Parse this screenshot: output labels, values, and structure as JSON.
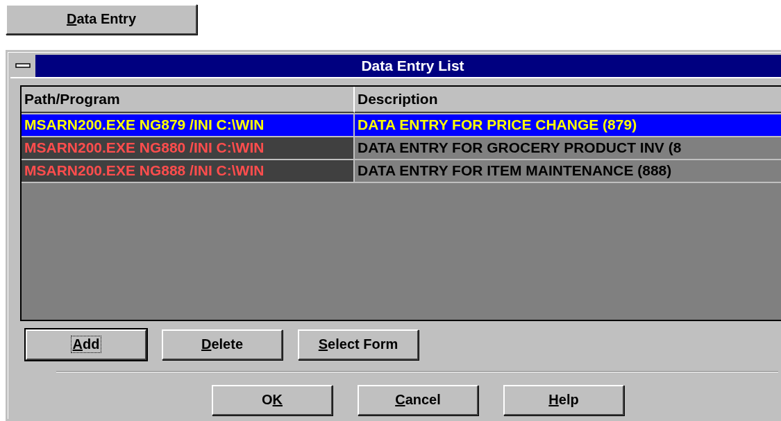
{
  "launcher_button": {
    "key": "D",
    "after": "ata Entry"
  },
  "window": {
    "title": "Data Entry List"
  },
  "table": {
    "columns": [
      "Path/Program",
      "Description"
    ],
    "rows": [
      {
        "selected": true,
        "cells": [
          "MSARN200.EXE NG879 /INI C:\\WIN",
          "DATA ENTRY FOR PRICE CHANGE (879)"
        ]
      },
      {
        "selected": false,
        "cells": [
          "MSARN200.EXE NG880 /INI C:\\WIN",
          "DATA ENTRY FOR GROCERY PRODUCT INV (8"
        ]
      },
      {
        "selected": false,
        "cells": [
          "MSARN200.EXE NG888 /INI C:\\WIN",
          "DATA ENTRY FOR ITEM MAINTENANCE (888)"
        ]
      }
    ]
  },
  "list_buttons": [
    {
      "key": "A",
      "after": "dd",
      "default": true
    },
    {
      "key": "D",
      "after": "elete",
      "default": false
    },
    {
      "key": "S",
      "after": "elect Form",
      "default": false
    }
  ],
  "dialog_buttons": [
    {
      "before": "O",
      "key": "K",
      "default": false
    },
    {
      "key": "C",
      "after": "ancel",
      "default": false
    },
    {
      "key": "H",
      "after": "elp",
      "default": false
    }
  ]
}
